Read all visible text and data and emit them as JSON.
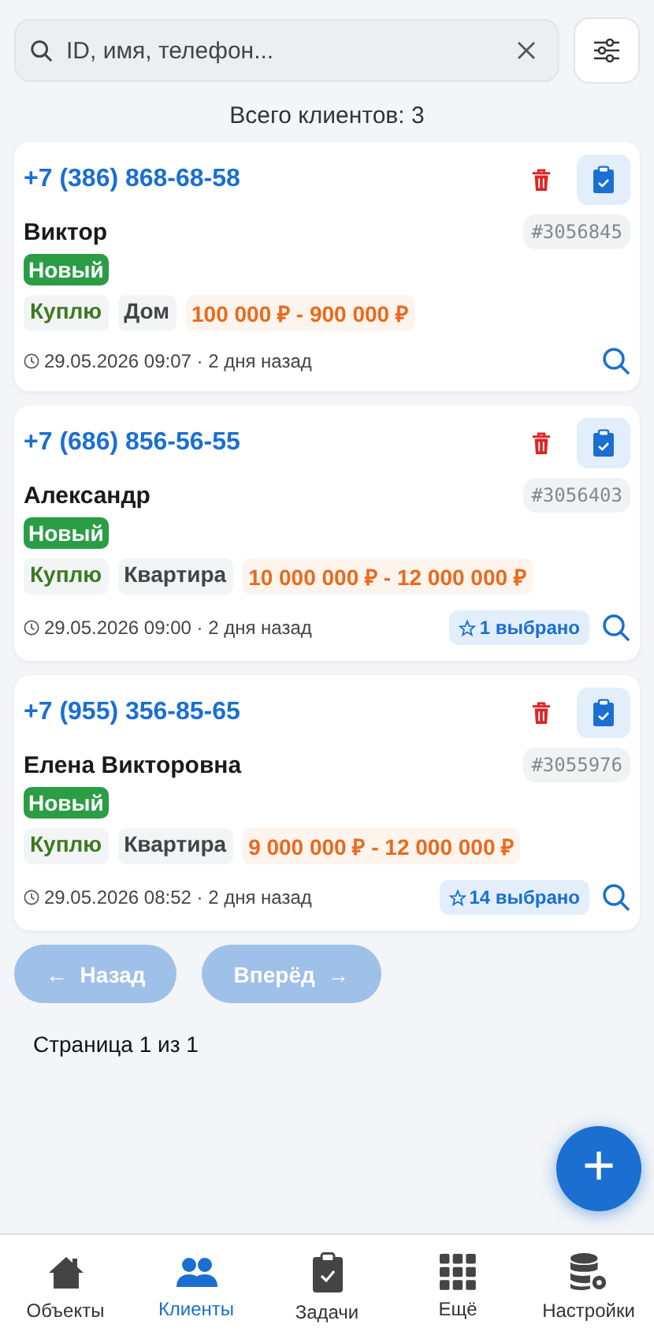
{
  "search": {
    "placeholder": "ID, имя, телефон..."
  },
  "total": "Всего клиентов: 3",
  "clients": [
    {
      "phone": "+7 (386) 868-68-58",
      "name": "Виктор",
      "id": "#3056845",
      "status": "Новый",
      "deal": "Куплю",
      "type": "Дом",
      "price": "100 000 ₽ - 900 000 ₽",
      "date": "29.05.2026 09:07 · 2 дня назад"
    },
    {
      "phone": "+7 (686) 856-56-55",
      "name": "Александр",
      "id": "#3056403",
      "status": "Новый",
      "deal": "Куплю",
      "type": "Квартира",
      "price": "10 000 000 ₽ - 12 000 000 ₽",
      "date": "29.05.2026 09:00 · 2 дня назад",
      "favorites": "1 выбрано"
    },
    {
      "phone": "+7 (955) 356-85-65",
      "name": "Елена Викторовна",
      "id": "#3055976",
      "status": "Новый",
      "deal": "Куплю",
      "type": "Квартира",
      "price": "9 000 000 ₽ - 12 000 000 ₽",
      "date": "29.05.2026 08:52 · 2 дня назад",
      "favorites": "14 выбрано"
    }
  ],
  "pagination": {
    "prev": {
      "label": "Назад",
      "arrow": "←",
      "disabled": true
    },
    "next": {
      "label": "Вперёд",
      "arrow": "→",
      "disabled": true
    },
    "page": "Страница 1 из 1"
  },
  "fab": "+",
  "nav": [
    {
      "kind": "home",
      "label": "Объекты",
      "selected": false
    },
    {
      "kind": "people",
      "label": "Клиенты",
      "selected": true
    },
    {
      "kind": "tasks",
      "label": "Задачи",
      "selected": false
    },
    {
      "kind": "grid",
      "label": "Ещё",
      "selected": false
    },
    {
      "kind": "settings",
      "label": "Настройки",
      "selected": false
    }
  ]
}
